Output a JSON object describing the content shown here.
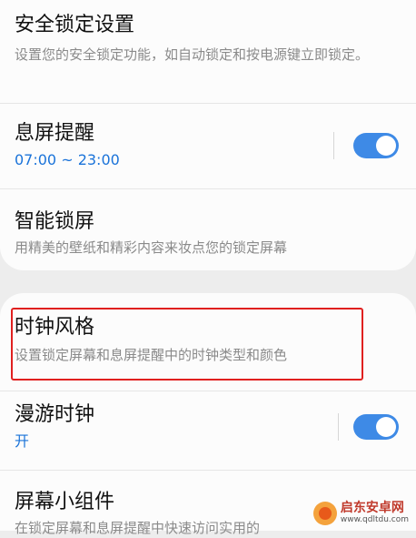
{
  "settings_top": {
    "secure_lock": {
      "title": "安全锁定设置",
      "subtitle": "设置您的安全锁定功能，如自动锁定和按电源键立即锁定。"
    },
    "aod": {
      "title": "息屏提醒",
      "subtitle": "07:00 ~ 23:00",
      "toggle_on": true
    },
    "smart_lock": {
      "title": "智能锁屏",
      "subtitle": "用精美的壁纸和精彩内容来妆点您的锁定屏幕"
    }
  },
  "settings_bottom": {
    "clock_style": {
      "title": "时钟风格",
      "subtitle": "设置锁定屏幕和息屏提醒中的时钟类型和颜色"
    },
    "roaming_clock": {
      "title": "漫游时钟",
      "subtitle": "开",
      "toggle_on": true
    },
    "widgets": {
      "title": "屏幕小组件",
      "subtitle": "在锁定屏幕和息屏提醒中快速访问实用的"
    }
  },
  "watermark": {
    "name": "启东安卓网",
    "url": "www.qdltdu.com"
  },
  "colors": {
    "accent": "#3e8ae6",
    "highlight": "#e0201f",
    "subtitle_blue": "#1a73d9"
  }
}
